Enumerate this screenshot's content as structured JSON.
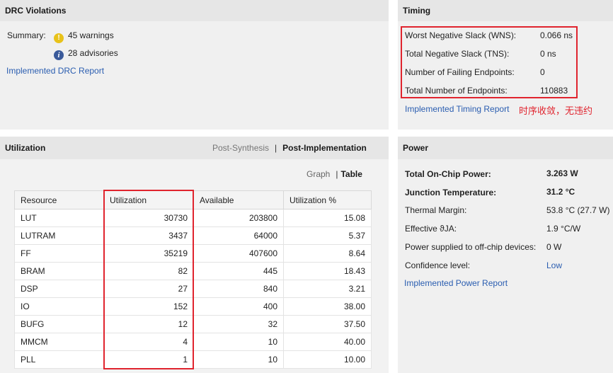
{
  "drc": {
    "title": "DRC Violations",
    "summary_label": "Summary:",
    "warnings": "45 warnings",
    "advisories": "28 advisories",
    "report_link": "Implemented DRC Report"
  },
  "timing": {
    "title": "Timing",
    "rows": [
      {
        "label": "Worst Negative Slack (WNS):",
        "value": "0.066 ns"
      },
      {
        "label": "Total Negative Slack (TNS):",
        "value": "0 ns"
      },
      {
        "label": "Number of Failing Endpoints:",
        "value": "0"
      },
      {
        "label": "Total Number of Endpoints:",
        "value": "110883"
      }
    ],
    "report_link": "Implemented Timing Report",
    "annotation": "时序收敛，无违约"
  },
  "utilization": {
    "title": "Utilization",
    "tab_post_synthesis": "Post-Synthesis",
    "tab_post_implementation": "Post-Implementation",
    "view_graph": "Graph",
    "view_table": "Table",
    "headers": [
      "Resource",
      "Utilization",
      "Available",
      "Utilization %"
    ],
    "rows": [
      [
        "LUT",
        "30730",
        "203800",
        "15.08"
      ],
      [
        "LUTRAM",
        "3437",
        "64000",
        "5.37"
      ],
      [
        "FF",
        "35219",
        "407600",
        "8.64"
      ],
      [
        "BRAM",
        "82",
        "445",
        "18.43"
      ],
      [
        "DSP",
        "27",
        "840",
        "3.21"
      ],
      [
        "IO",
        "152",
        "400",
        "38.00"
      ],
      [
        "BUFG",
        "12",
        "32",
        "37.50"
      ],
      [
        "MMCM",
        "4",
        "10",
        "40.00"
      ],
      [
        "PLL",
        "1",
        "10",
        "10.00"
      ]
    ]
  },
  "power": {
    "title": "Power",
    "rows": [
      {
        "label": "Total On-Chip Power:",
        "value": "3.263 W",
        "bold": true
      },
      {
        "label": "Junction Temperature:",
        "value": "31.2 °C",
        "bold": true
      },
      {
        "label": "Thermal Margin:",
        "value": "53.8 °C (27.7 W)",
        "bold": false
      },
      {
        "label": "Effective ϑJA:",
        "value": "1.9 °C/W",
        "bold": false
      },
      {
        "label": "Power supplied to off-chip devices:",
        "value": "0 W",
        "bold": false
      },
      {
        "label": "Confidence level:",
        "value": "Low",
        "bold": false,
        "link": true
      }
    ],
    "report_link": "Implemented Power Report"
  },
  "colors": {
    "highlight": "#e0242e",
    "link": "#2a5db0",
    "warning": "#e8c21a",
    "info": "#3a5a9a"
  }
}
